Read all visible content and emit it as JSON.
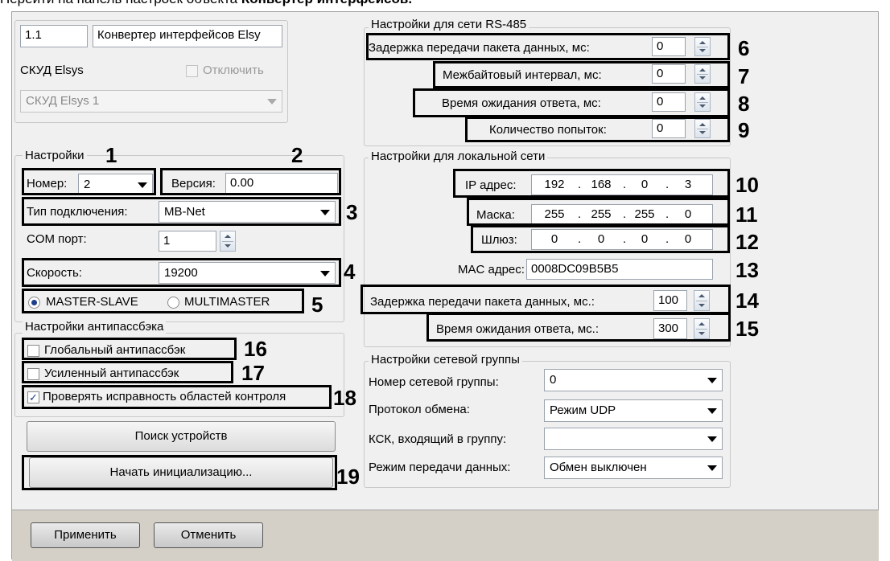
{
  "caption": {
    "text": "Перейти на панель настроек объекта ",
    "bold": "Конвертер интерфейсов."
  },
  "object": {
    "id": "1.1",
    "name": "Конвертер интерфейсов Elsy",
    "parent": "СКУД Elsys",
    "disable_label": "Отключить",
    "parent_select": "СКУД Elsys 1"
  },
  "settings": {
    "title": "Настройки",
    "number_label": "Номер:",
    "number_value": "2",
    "version_label": "Версия:",
    "version_value": "0.00",
    "conn_type_label": "Тип подключения:",
    "conn_type_value": "MB-Net",
    "com_label": "COM порт:",
    "com_value": "1",
    "speed_label": "Скорость:",
    "speed_value": "19200",
    "mode_master_slave": "MASTER-SLAVE",
    "mode_multimaster": "MULTIMASTER"
  },
  "antipassback": {
    "title": "Настройки антипассбэка",
    "global": "Глобальный антипассбэк",
    "enhanced": "Усиленный антипассбэк",
    "check_areas": "Проверять исправность областей контроля"
  },
  "buttons": {
    "search": "Поиск устройств",
    "init": "Начать инициализацию...",
    "apply": "Применить",
    "cancel": "Отменить"
  },
  "rs485": {
    "title": "Настройки для сети RS-485",
    "delay_label": "Задержка передачи пакета данных, мс:",
    "delay_value": "0",
    "interbyte_label": "Межбайтовый интервал, мс:",
    "interbyte_value": "0",
    "wait_label": "Время ожидания ответа, мс:",
    "wait_value": "0",
    "attempts_label": "Количество попыток:",
    "attempts_value": "0"
  },
  "lan": {
    "title": "Настройки для локальной сети",
    "ip_label": "IP адрес:",
    "ip": [
      "192",
      "168",
      "0",
      "3"
    ],
    "mask_label": "Маска:",
    "mask": [
      "255",
      "255",
      "255",
      "0"
    ],
    "gateway_label": "Шлюз:",
    "gateway": [
      "0",
      "0",
      "0",
      "0"
    ],
    "mac_label": "MAC адрес:",
    "mac_value": "0008DC09B5B5",
    "delay_label": "Задержка передачи пакета данных, мс.:",
    "delay_value": "100",
    "wait_label": "Время ожидания ответа, мс.:",
    "wait_value": "300"
  },
  "netgroup": {
    "title": "Настройки сетевой группы",
    "number_label": "Номер сетевой группы:",
    "number_value": "0",
    "protocol_label": "Протокол обмена:",
    "protocol_value": "Режим UDP",
    "ksk_label": "КСК, входящий в группу:",
    "ksk_value": "",
    "mode_label": "Режим передачи данных:",
    "mode_value": "Обмен выключен"
  },
  "callouts": [
    "1",
    "2",
    "3",
    "4",
    "5",
    "6",
    "7",
    "8",
    "9",
    "10",
    "11",
    "12",
    "13",
    "14",
    "15",
    "16",
    "17",
    "18",
    "19"
  ],
  "dots": "."
}
